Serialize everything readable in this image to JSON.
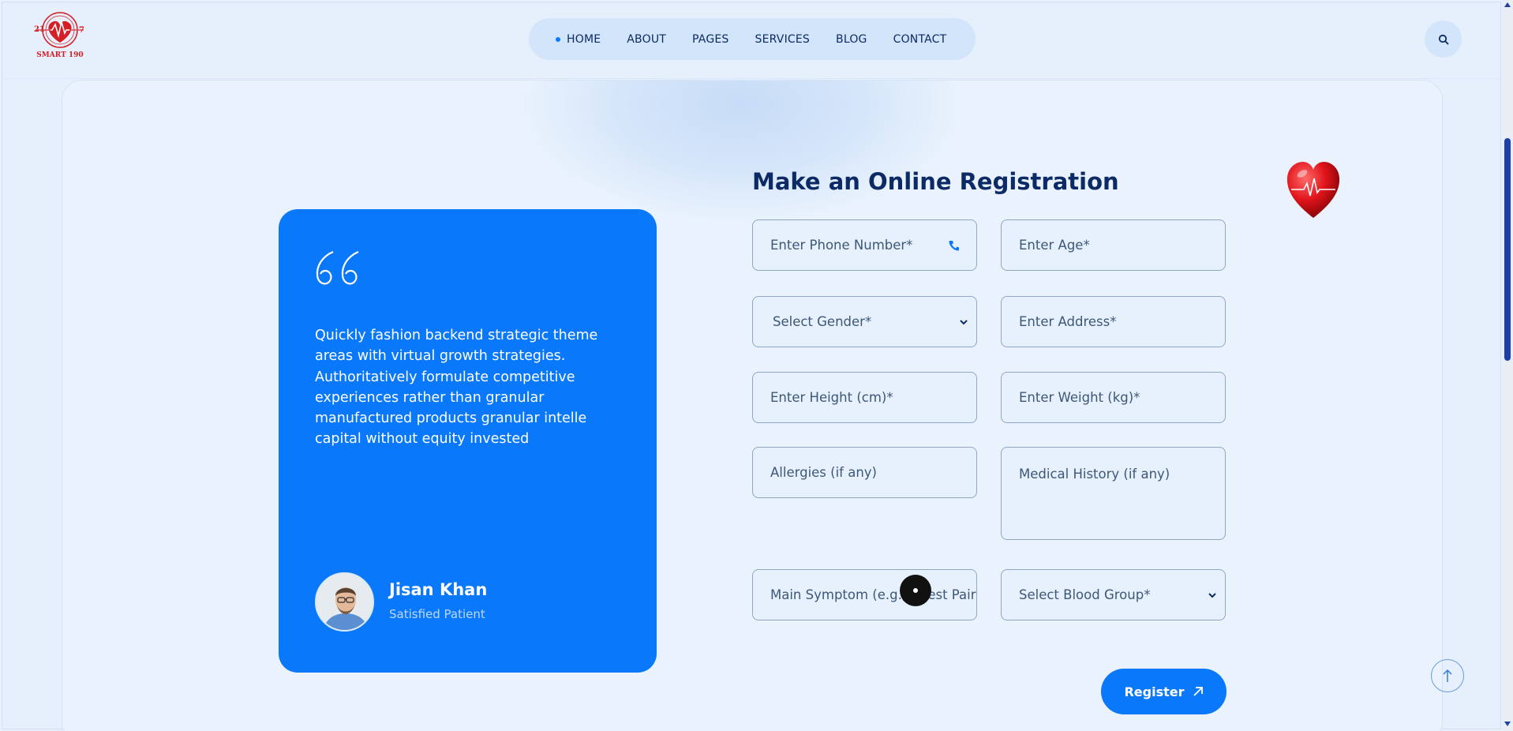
{
  "logo": {
    "top_left": "21",
    "top_right": "7",
    "name": "SMART 190",
    "icon": "heart-ecg-logo"
  },
  "nav": {
    "items": [
      {
        "label": "HOME",
        "active": true
      },
      {
        "label": "ABOUT"
      },
      {
        "label": "PAGES"
      },
      {
        "label": "SERVICES"
      },
      {
        "label": "BLOG"
      },
      {
        "label": "CONTACT"
      }
    ],
    "search_icon": "search-icon"
  },
  "testimonial": {
    "quote_icon": "quote-icon",
    "text": "Quickly fashion backend strategic theme areas with virtual growth strategies. Authoritatively formulate competitive experiences rather than granular manufactured products granular intelle capital without equity invested",
    "author_name": "Jisan Khan",
    "author_role": "Satisfied Patient"
  },
  "form": {
    "title": "Make an Online Registration",
    "fields": {
      "phone": "Enter Phone Number*",
      "age": "Enter Age*",
      "gender": "Select Gender*",
      "address": "Enter Address*",
      "height": "Enter Height (cm)*",
      "weight": "Enter Weight (kg)*",
      "allergies": "Allergies (if any)",
      "medical_history": "Medical History (if any)",
      "symptom": "Main Symptom (e.g., Chest Pair",
      "blood_group": "Select Blood Group*"
    },
    "submit_label": "Register"
  },
  "colors": {
    "accent": "#0a78fb",
    "heading": "#0b2a66",
    "background": "#e8f2fd"
  }
}
